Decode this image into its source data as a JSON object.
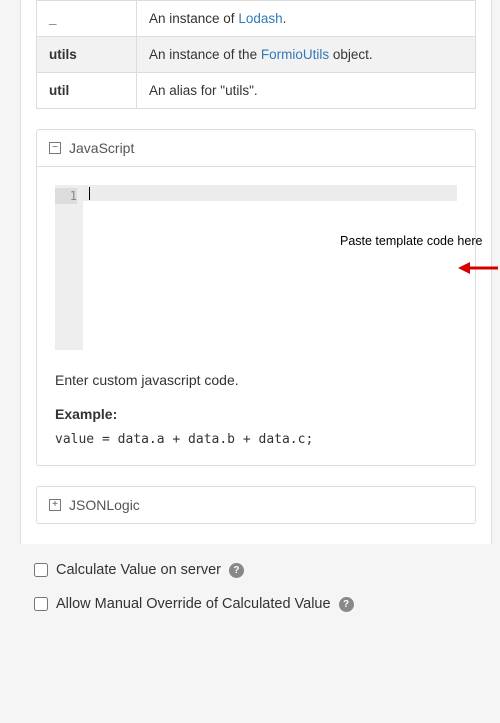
{
  "variables": [
    {
      "name": "_",
      "desc_prefix": "An instance of ",
      "link": "Lodash",
      "desc_suffix": "."
    },
    {
      "name": "utils",
      "desc_prefix": "An instance of the ",
      "link": "FormioUtils",
      "desc_suffix": " object."
    },
    {
      "name": "util",
      "desc_prefix": "An alias for \"utils\".",
      "link": "",
      "desc_suffix": ""
    }
  ],
  "js_panel": {
    "title": "JavaScript",
    "line_number": "1",
    "hint": "Enter custom javascript code.",
    "example_label": "Example:",
    "example_code": "value = data.a + data.b + data.c;"
  },
  "jsonlogic_panel": {
    "title": "JSONLogic"
  },
  "checkboxes": {
    "server": "Calculate Value on server",
    "override": "Allow Manual Override of Calculated Value"
  },
  "annotation": {
    "text": "Paste template code here"
  }
}
